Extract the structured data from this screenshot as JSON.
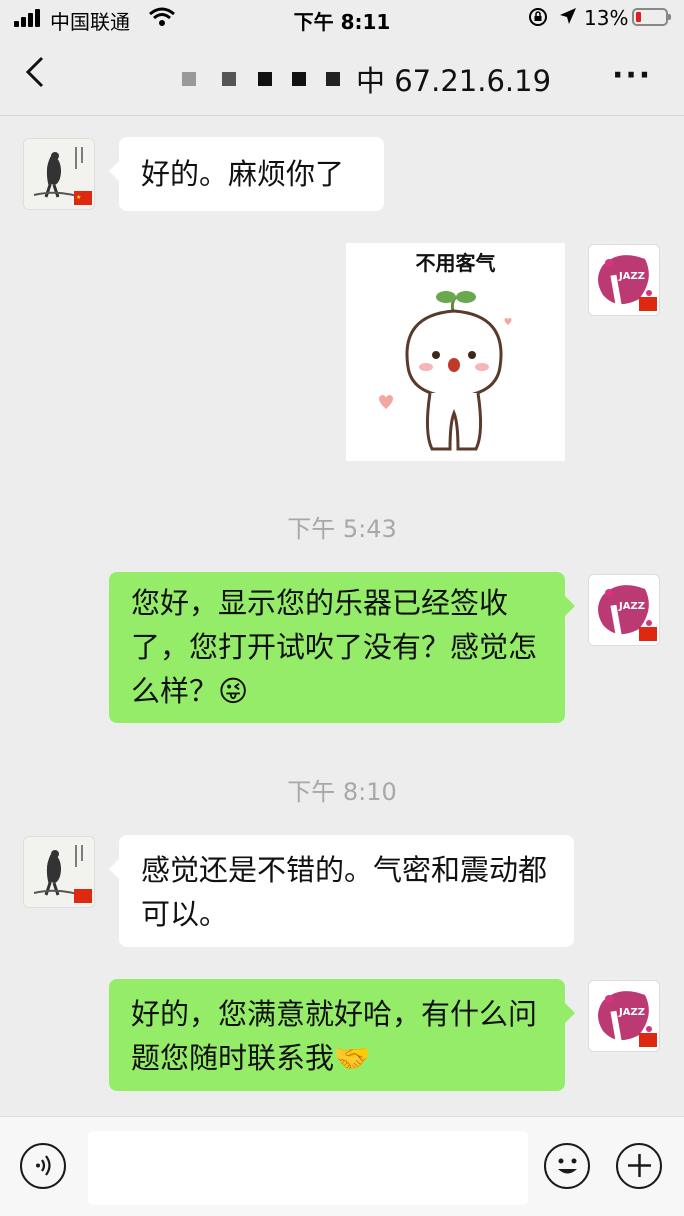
{
  "status_bar": {
    "carrier": "中国联通",
    "time": "下午 8:11",
    "battery_percent": "13%",
    "battery_level": 0.13
  },
  "nav": {
    "title": "中 67.21.6.19"
  },
  "messages": [
    {
      "side": "left",
      "text": "好的。麻烦你了"
    },
    {
      "side": "right",
      "type": "sticker",
      "text": "不用客气"
    },
    {
      "type": "timestamp",
      "text": "下午 5:43"
    },
    {
      "side": "right",
      "text": "您好，显示您的乐器已经签收了，您打开试吹了没有？感觉怎么样？😜"
    },
    {
      "type": "timestamp",
      "text": "下午 8:10"
    },
    {
      "side": "left",
      "text": "感觉还是不错的。气密和震动都可以。"
    },
    {
      "side": "right",
      "text": "好的，您满意就好哈，有什么问题您随时联系我🤝"
    }
  ],
  "colors": {
    "background": "#ededed",
    "outgoing_bubble": "#95ec69",
    "incoming_bubble": "#ffffff",
    "sticker_accent": "#b0185a"
  },
  "icons": [
    "back-icon",
    "more-icon",
    "voice-icon",
    "emoji-icon",
    "plus-icon"
  ]
}
